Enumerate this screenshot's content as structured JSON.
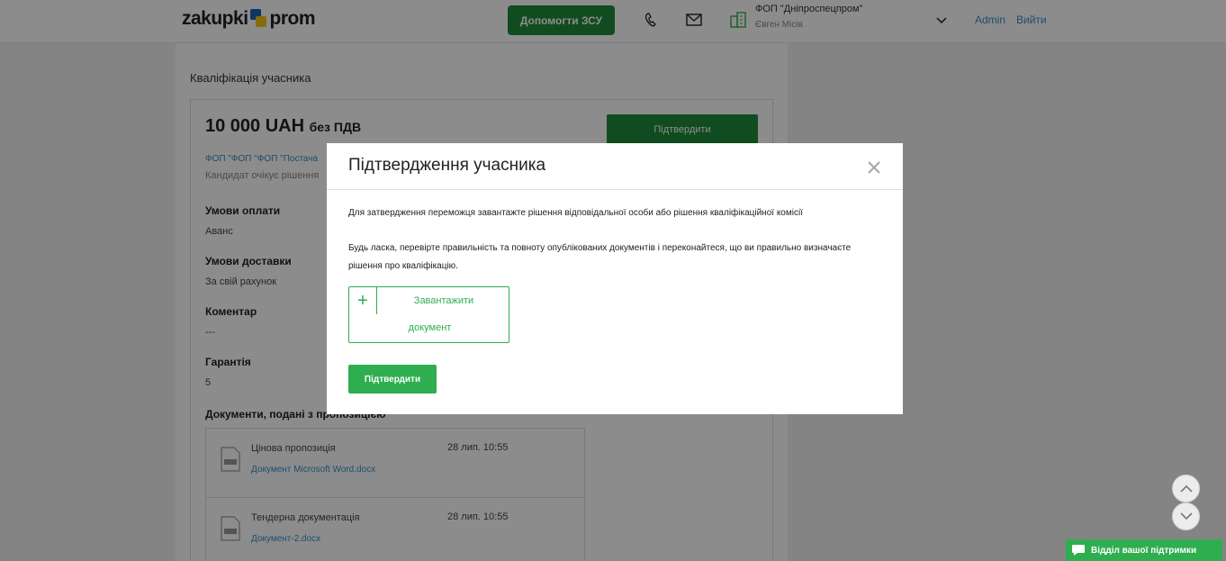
{
  "header": {
    "logo_left": "zakupki",
    "logo_right": "prom",
    "help_button": "Допомогти ЗСУ",
    "org_name": "ФОП \"Дніпроспецпром\"",
    "org_user": "Євген Місів",
    "admin_link": "Admin",
    "logout_link": "Вийти"
  },
  "page": {
    "title": "Кваліфікація учасника",
    "price_amount": "10 000 UAH",
    "price_suffix": "без ПДВ",
    "confirm_button": "Підтвердити",
    "supplier_link": "ФОП \"ФОП \"ФОП \"Постача",
    "candidate_status": "Кандидат очікує рішення",
    "fields": [
      {
        "label": "Умови оплати",
        "value": "Аванс"
      },
      {
        "label": "Умови доставки",
        "value": "За свій рахунок"
      },
      {
        "label": "Коментар",
        "value": "---"
      },
      {
        "label": "Гарантія",
        "value": "5"
      }
    ],
    "documents_title": "Документи, подані з пропозицією",
    "documents": [
      {
        "name": "Цінова пропозиція",
        "file": "Документ Microsoft Word.docx",
        "date": "28 лип. 10:55"
      },
      {
        "name": "Тендерна документація",
        "file": "Документ-2.docx",
        "date": "28 лип. 10:55"
      }
    ]
  },
  "modal": {
    "title": "Підтвердження учасника",
    "text1": "Для затвердження переможця завантажте рішення відповідальної особи або рішення кваліфікаційної комісії",
    "text2": "Будь ласка, перевірте правильність та повноту опублікованих документів і переконайтеся, що ви правильно визначаєте рішення про кваліфікацію.",
    "upload_line1": "Завантажити",
    "upload_line2": "документ",
    "confirm_button": "Підтвердити"
  },
  "support": {
    "label": "Відділ вашої підтримки"
  },
  "colors": {
    "brand_green": "#2eae4f",
    "dark_green": "#1e8a3a",
    "link_blue": "#3a8dc5"
  }
}
